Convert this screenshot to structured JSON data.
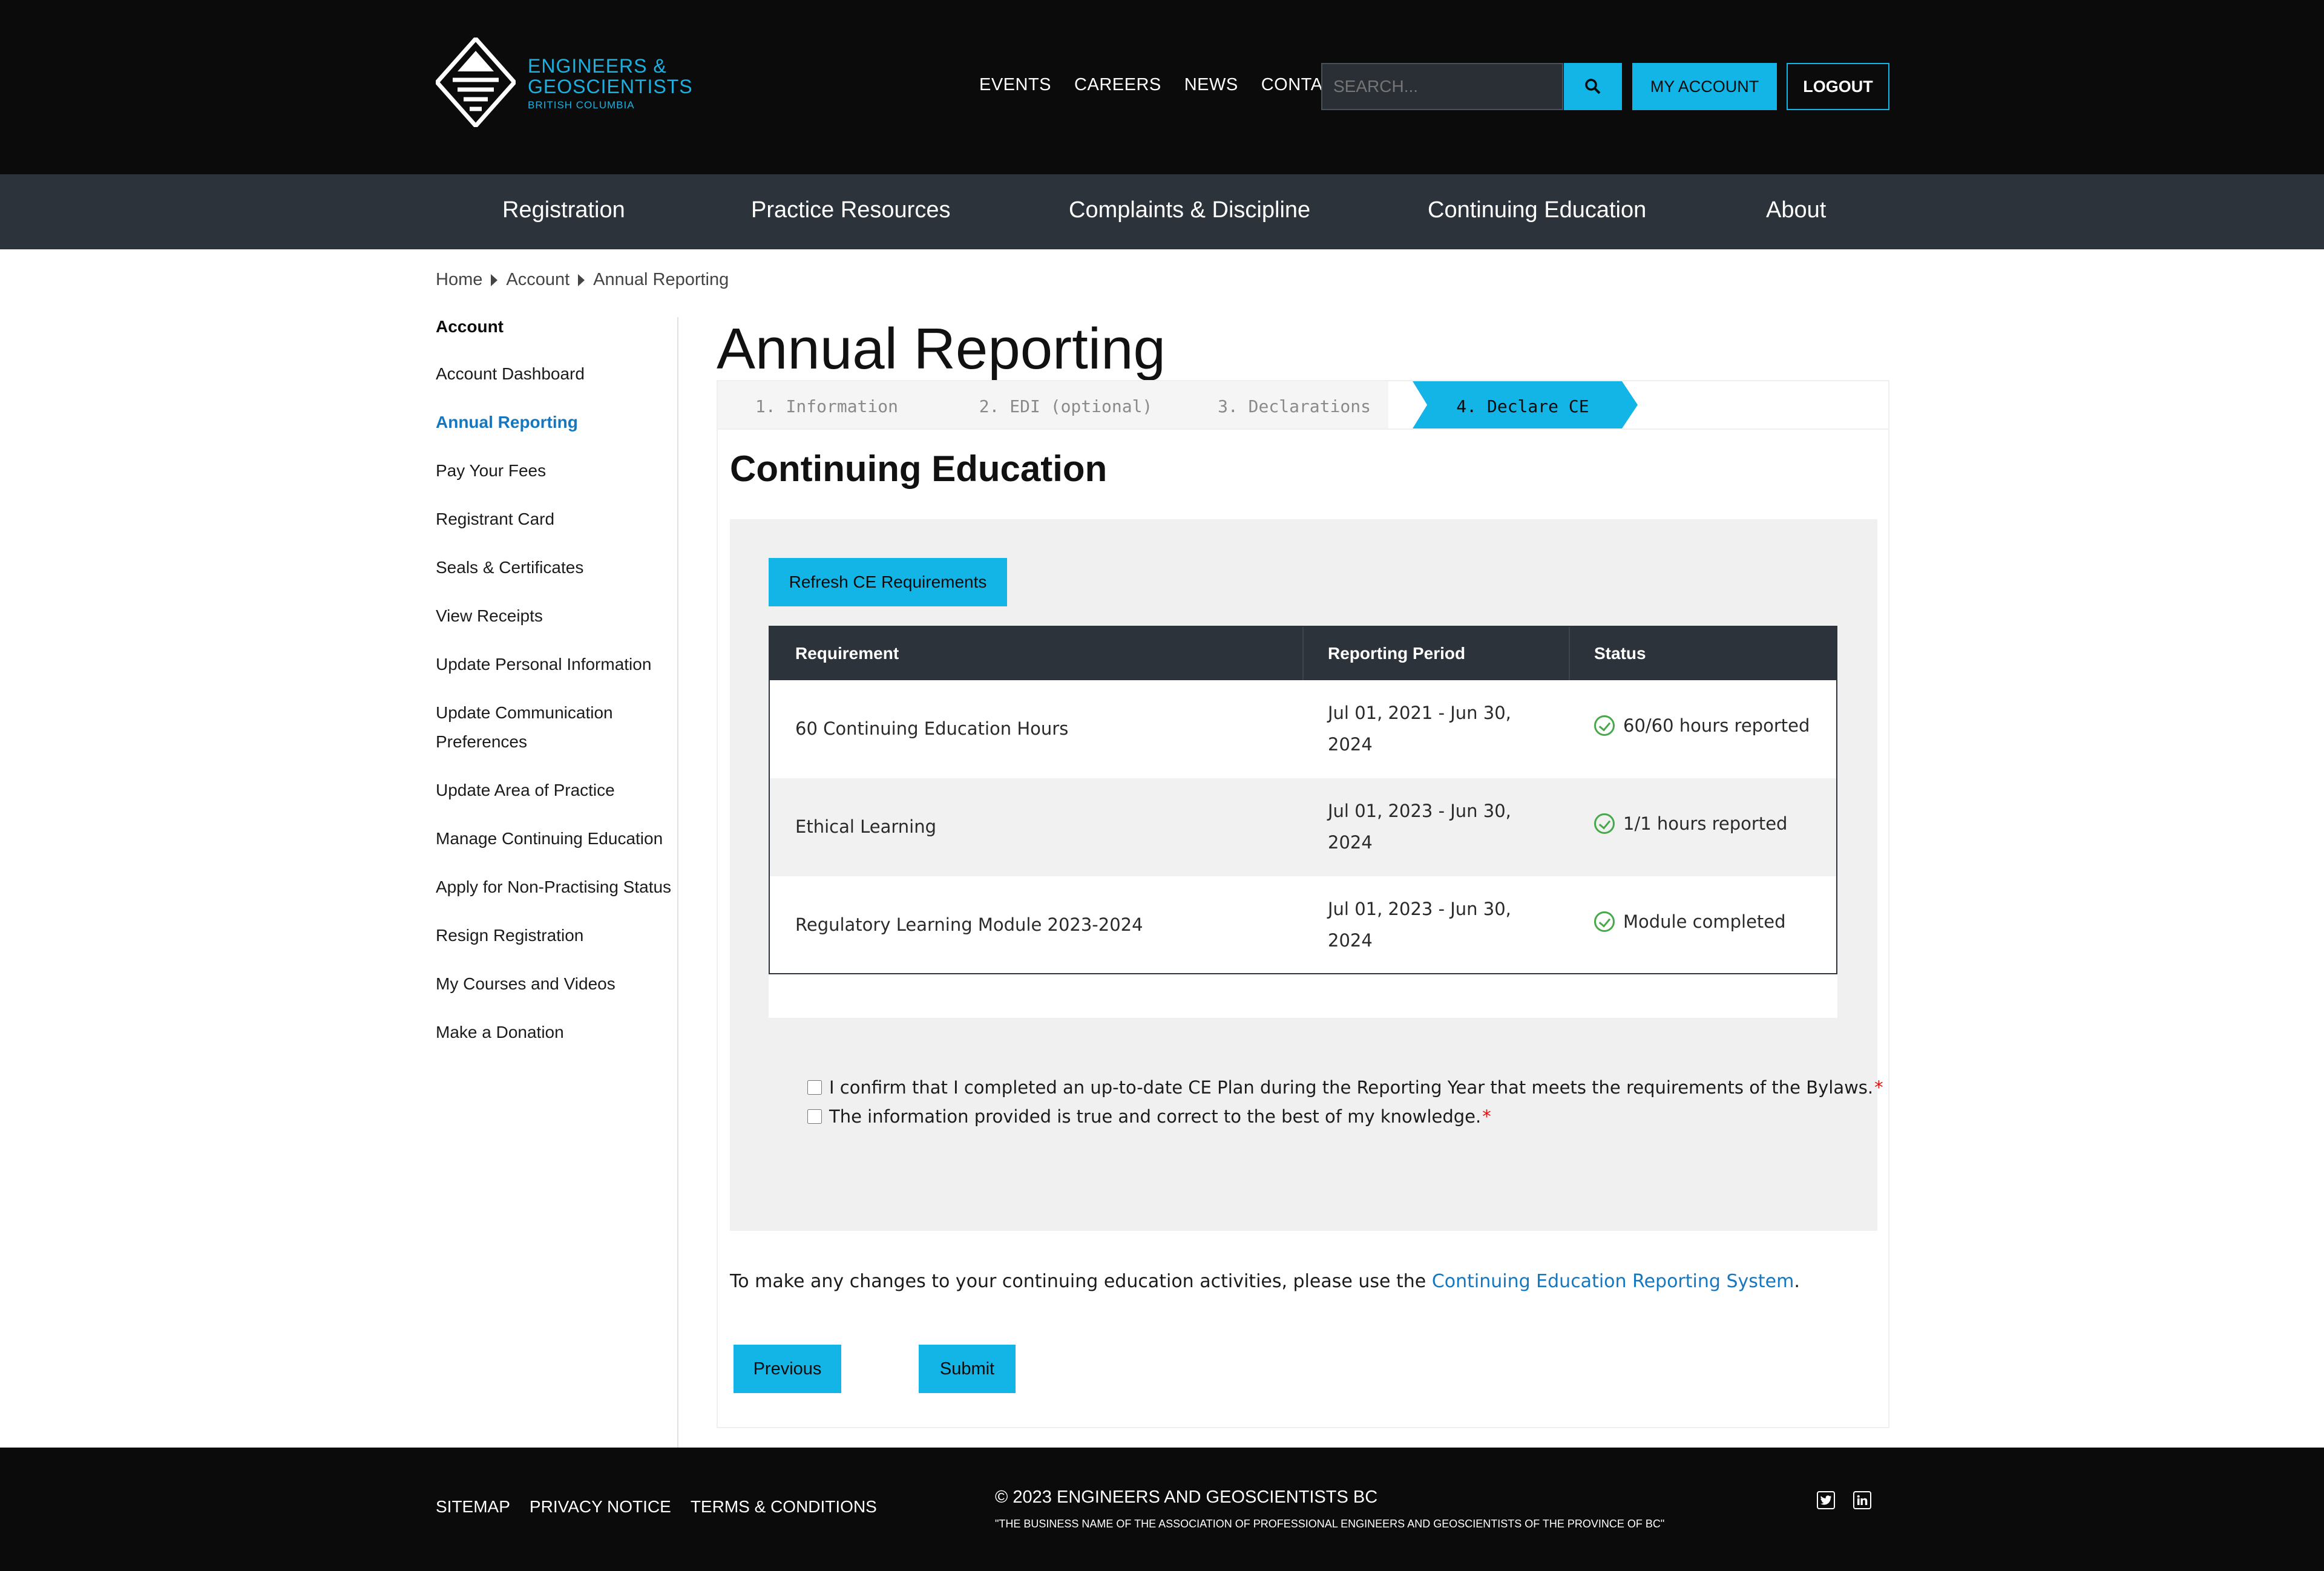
{
  "header": {
    "logo": {
      "line1": "ENGINEERS &",
      "line2": "GEOSCIENTISTS",
      "line3": "BRITISH COLUMBIA"
    },
    "topnav": [
      "EVENTS",
      "CAREERS",
      "NEWS",
      "CONTACT"
    ],
    "search": {
      "placeholder": "SEARCH..."
    },
    "my_account_label": "MY ACCOUNT",
    "logout_label": "LOGOUT"
  },
  "mainnav": [
    "Registration",
    "Practice Resources",
    "Complaints & Discipline",
    "Continuing Education",
    "About"
  ],
  "breadcrumb": [
    "Home",
    "Account",
    "Annual Reporting"
  ],
  "sidebar": {
    "heading": "Account",
    "items": [
      {
        "label": "Account Dashboard"
      },
      {
        "label": "Annual Reporting",
        "active": true
      },
      {
        "label": "Pay Your Fees"
      },
      {
        "label": "Registrant Card"
      },
      {
        "label": "Seals & Certificates"
      },
      {
        "label": "View Receipts"
      },
      {
        "label": "Update Personal Information"
      },
      {
        "label": "Update Communication Preferences"
      },
      {
        "label": "Update Area of Practice"
      },
      {
        "label": "Manage Continuing Education"
      },
      {
        "label": "Apply for Non-Practising Status"
      },
      {
        "label": "Resign Registration"
      },
      {
        "label": "My Courses and Videos"
      },
      {
        "label": "Make a Donation"
      }
    ]
  },
  "main": {
    "title": "Annual Reporting",
    "steps": [
      {
        "label": "1. Information",
        "active": false
      },
      {
        "label": "2. EDI (optional)",
        "active": false
      },
      {
        "label": "3. Declarations",
        "active": false
      },
      {
        "label": "4. Declare CE",
        "active": true
      }
    ],
    "section_title": "Continuing Education",
    "refresh_label": "Refresh CE Requirements",
    "table": {
      "headers": [
        "Requirement",
        "Reporting Period",
        "Status"
      ],
      "rows": [
        {
          "requirement": "60 Continuing Education Hours",
          "period_line1": "Jul 01, 2021 - Jun 30,",
          "period_line2": "2024",
          "status": "60/60 hours reported"
        },
        {
          "requirement": "Ethical Learning",
          "period_line1": "Jul 01, 2023 - Jun 30,",
          "period_line2": "2024",
          "status": "1/1 hours reported"
        },
        {
          "requirement": "Regulatory Learning Module 2023-2024",
          "period_line1": "Jul 01, 2023 - Jun 30,",
          "period_line2": "2024",
          "status": "Module completed"
        }
      ]
    },
    "confirmations": [
      {
        "text": "I confirm that I completed an up-to-date CE Plan during the Reporting Year that meets the requirements of the Bylaws.",
        "required_mark": "*",
        "checked": false
      },
      {
        "text": "The information provided is true and correct to the best of my knowledge.",
        "required_mark": "*",
        "checked": false
      }
    ],
    "note_prefix": "To make any changes to your continuing education activities, please use the ",
    "note_link": "Continuing Education Reporting System",
    "note_suffix": ".",
    "previous_label": "Previous",
    "submit_label": "Submit"
  },
  "footer": {
    "links": [
      "SITEMAP",
      "PRIVACY NOTICE",
      "TERMS & CONDITIONS"
    ],
    "copyright": "© 2023 ENGINEERS AND GEOSCIENTISTS BC",
    "tagline": "\"THE BUSINESS NAME OF THE ASSOCIATION OF PROFESSIONAL ENGINEERS AND GEOSCIENTISTS OF THE PROVINCE OF BC\"",
    "social": [
      "twitter-icon",
      "linkedin-icon"
    ]
  },
  "colors": {
    "accent": "#12b5e6",
    "header_bg": "#0b0b0b",
    "nav_bg": "#2c333b",
    "link": "#1577bf",
    "success": "#45a949",
    "required": "#dd1111"
  }
}
